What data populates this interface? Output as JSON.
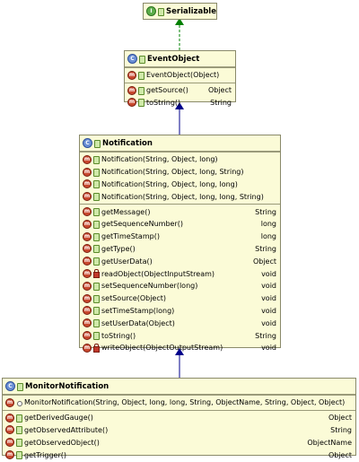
{
  "diagram": {
    "serializable": {
      "name": "Serializable",
      "kind": "interface"
    },
    "event_object": {
      "name": "EventObject",
      "constructors": [
        {
          "sig": "EventObject(Object)",
          "ret": "",
          "vis": "public"
        }
      ],
      "methods": [
        {
          "sig": "getSource()",
          "ret": "Object",
          "vis": "public"
        },
        {
          "sig": "toString()",
          "ret": "String",
          "vis": "public"
        }
      ]
    },
    "notification": {
      "name": "Notification",
      "constructors": [
        {
          "sig": "Notification(String, Object, long)",
          "ret": "",
          "vis": "public"
        },
        {
          "sig": "Notification(String, Object, long, String)",
          "ret": "",
          "vis": "public"
        },
        {
          "sig": "Notification(String, Object, long, long)",
          "ret": "",
          "vis": "public"
        },
        {
          "sig": "Notification(String, Object, long, long, String)",
          "ret": "",
          "vis": "public"
        }
      ],
      "methods": [
        {
          "sig": "getMessage()",
          "ret": "String",
          "vis": "public"
        },
        {
          "sig": "getSequenceNumber()",
          "ret": "long",
          "vis": "public"
        },
        {
          "sig": "getTimeStamp()",
          "ret": "long",
          "vis": "public"
        },
        {
          "sig": "getType()",
          "ret": "String",
          "vis": "public"
        },
        {
          "sig": "getUserData()",
          "ret": "Object",
          "vis": "public"
        },
        {
          "sig": "readObject(ObjectInputStream)",
          "ret": "void",
          "vis": "private"
        },
        {
          "sig": "setSequenceNumber(long)",
          "ret": "void",
          "vis": "public"
        },
        {
          "sig": "setSource(Object)",
          "ret": "void",
          "vis": "public"
        },
        {
          "sig": "setTimeStamp(long)",
          "ret": "void",
          "vis": "public"
        },
        {
          "sig": "setUserData(Object)",
          "ret": "void",
          "vis": "public"
        },
        {
          "sig": "toString()",
          "ret": "String",
          "vis": "public"
        },
        {
          "sig": "writeObject(ObjectOutputStream)",
          "ret": "void",
          "vis": "private"
        }
      ]
    },
    "monitor_notification": {
      "name": "MonitorNotification",
      "constructors": [
        {
          "sig": "MonitorNotification(String, Object, long, long, String, ObjectName, String, Object, Object)",
          "ret": "",
          "vis": "package"
        }
      ],
      "methods": [
        {
          "sig": "getDerivedGauge()",
          "ret": "Object",
          "vis": "public"
        },
        {
          "sig": "getObservedAttribute()",
          "ret": "String",
          "vis": "public"
        },
        {
          "sig": "getObservedObject()",
          "ret": "ObjectName",
          "vis": "public"
        },
        {
          "sig": "getTrigger()",
          "ret": "Object",
          "vis": "public"
        }
      ]
    },
    "colors": {
      "class_fill": "#fbfbd7",
      "inheritance_arrow": "#00008b",
      "implements_arrow": "#008000",
      "method_icon": "#c8482e"
    }
  }
}
